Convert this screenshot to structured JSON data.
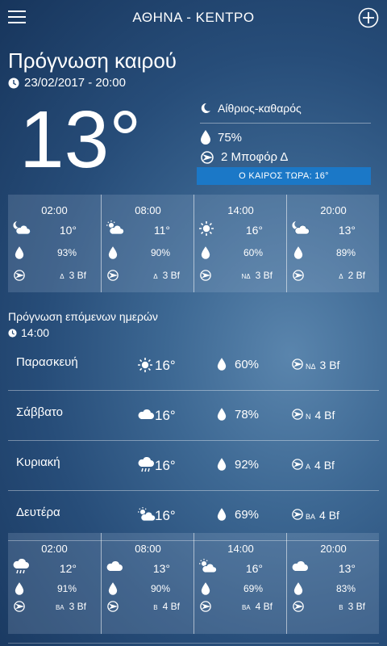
{
  "header": {
    "city": "ΑΘΗΝΑ - ΚΕΝΤΡΟ",
    "icons": {
      "menu": "hamburger-icon",
      "add": "plus-circle-icon"
    }
  },
  "current": {
    "title": "Πρόγνωση καιρού",
    "datetime": "23/02/2017 - 20:00",
    "temp": "13°",
    "sky": "Αίθριος-καθαρός",
    "humidity": "75%",
    "wind": "2 Μποφόρ Δ",
    "now_label": "Ο ΚΑΙΡΟΣ ΤΩΡΑ: 16°"
  },
  "hourly_top": [
    {
      "time": "02:00",
      "icon": "cloud-moon-icon",
      "temp": "10°",
      "hum": "93%",
      "dir": "Δ",
      "bf": "3 Bf"
    },
    {
      "time": "08:00",
      "icon": "cloud-sun-icon",
      "temp": "11°",
      "hum": "90%",
      "dir": "Δ",
      "bf": "3 Bf"
    },
    {
      "time": "14:00",
      "icon": "sun-icon",
      "temp": "16°",
      "hum": "60%",
      "dir": "ΝΔ",
      "bf": "3 Bf"
    },
    {
      "time": "20:00",
      "icon": "cloud-moon-icon",
      "temp": "13°",
      "hum": "89%",
      "dir": "Δ",
      "bf": "2 Bf"
    }
  ],
  "next_days": {
    "title": "Πρόγνωση επόμενων ημερών",
    "time": "14:00",
    "days": [
      {
        "name": "Παρασκευή",
        "icon": "sun-icon",
        "temp": "16°",
        "hum": "60%",
        "dir": "ΝΔ",
        "bf": "3 Bf"
      },
      {
        "name": "Σάββατο",
        "icon": "cloud-icon",
        "temp": "16°",
        "hum": "78%",
        "dir": "Ν",
        "bf": "4 Bf"
      },
      {
        "name": "Κυριακή",
        "icon": "rain-cloud-icon",
        "temp": "16°",
        "hum": "92%",
        "dir": "Α",
        "bf": "4 Bf"
      },
      {
        "name": "Δευτέρα",
        "icon": "cloud-sun-icon",
        "temp": "16°",
        "hum": "69%",
        "dir": "ΒΑ",
        "bf": "4 Bf"
      }
    ]
  },
  "hourly_bottom": [
    {
      "time": "02:00",
      "icon": "rain-cloud-icon",
      "temp": "12°",
      "hum": "91%",
      "dir": "ΒΑ",
      "bf": "3 Bf"
    },
    {
      "time": "08:00",
      "icon": "cloud-icon",
      "temp": "13°",
      "hum": "90%",
      "dir": "Β",
      "bf": "4 Bf"
    },
    {
      "time": "14:00",
      "icon": "cloud-sun-icon",
      "temp": "16°",
      "hum": "69%",
      "dir": "ΒΑ",
      "bf": "4 Bf"
    },
    {
      "time": "20:00",
      "icon": "cloud-icon",
      "temp": "13°",
      "hum": "83%",
      "dir": "Β",
      "bf": "3 Bf"
    }
  ]
}
